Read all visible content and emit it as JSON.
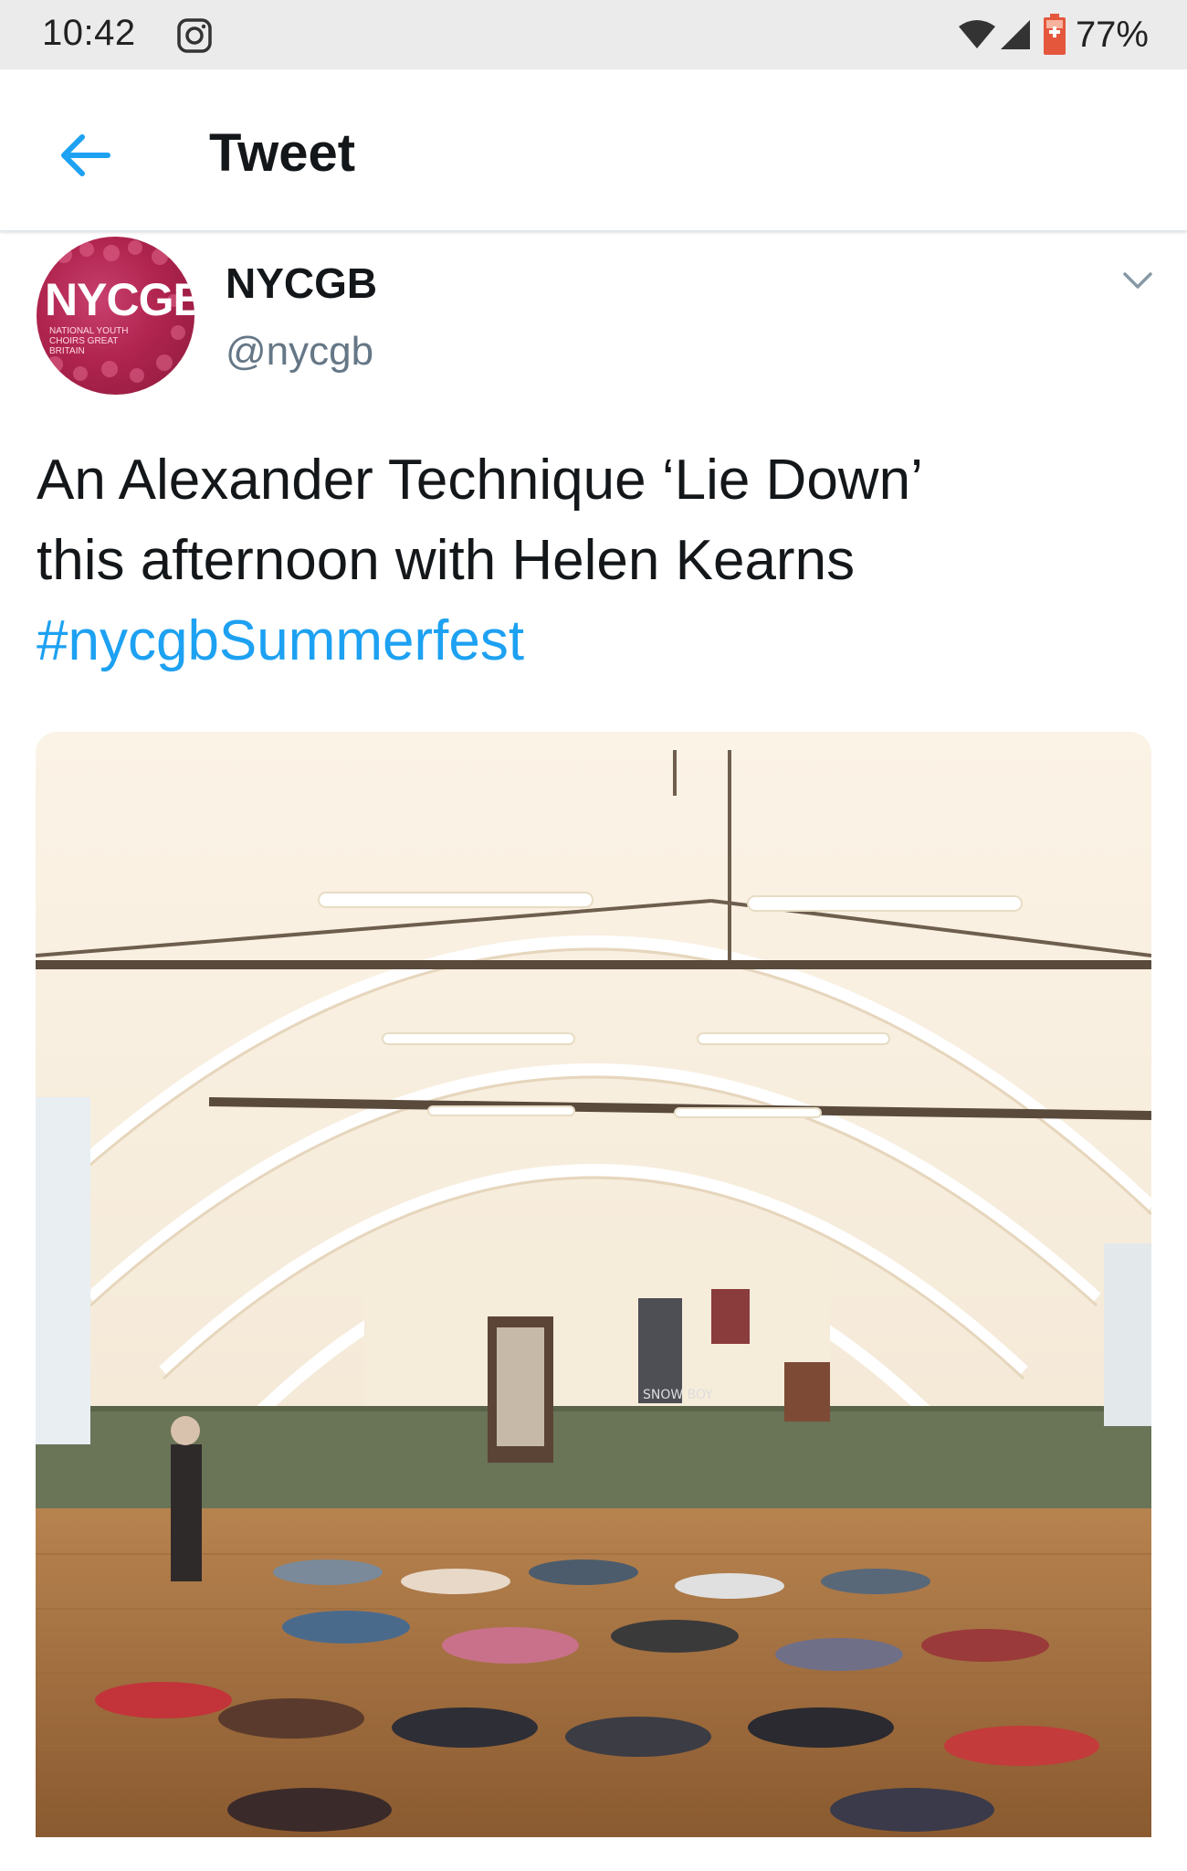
{
  "status_bar": {
    "time": "10:42",
    "battery_percent": "77%",
    "icons": [
      "instagram-icon",
      "wifi-icon",
      "cell-signal-icon",
      "battery-charging-icon"
    ]
  },
  "app_bar": {
    "title": "Tweet",
    "back_icon": "arrow-left-icon",
    "accent_color": "#1da1f2"
  },
  "tweet": {
    "display_name": "NYCGB",
    "handle": "@nycgb",
    "avatar_logo": "NYCGB",
    "avatar_subtitle": "National Youth Choirs Great Britain",
    "text_lines": [
      "An Alexander Technique ‘Lie Down’",
      "this afternoon with Helen Kearns"
    ],
    "hashtag": "#nycgbSummerfest",
    "menu_icon": "chevron-down-icon"
  },
  "media": {
    "sign_text": "SNOW BOY"
  }
}
